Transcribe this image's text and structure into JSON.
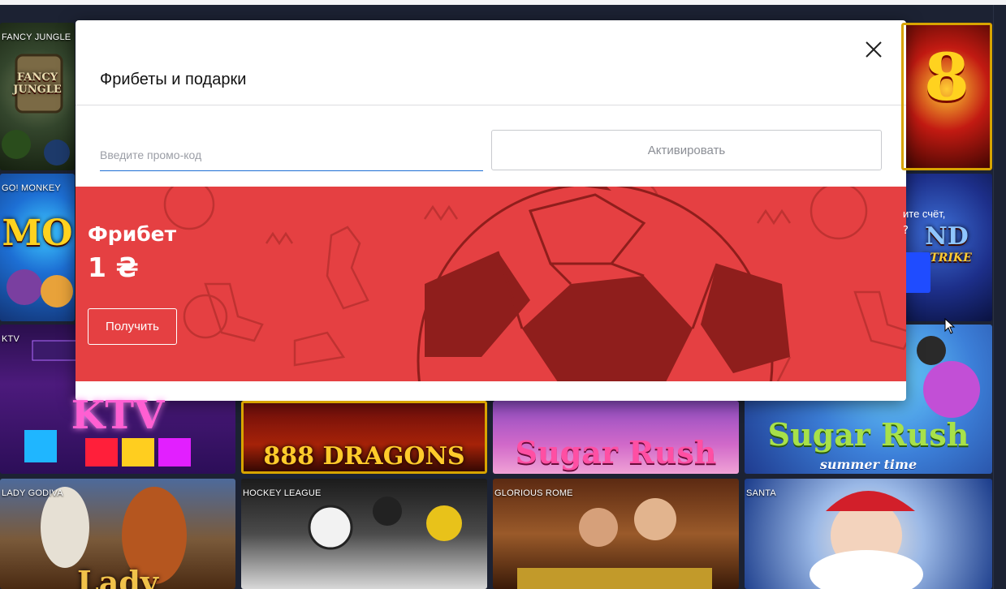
{
  "modal": {
    "title": "Фрибеты и подарки",
    "promo_placeholder": "Введите промо-код",
    "activate_label": "Активировать",
    "banner": {
      "title": "Фрибет",
      "amount": "1 ₴",
      "button_label": "Получить",
      "color": "#e54042"
    }
  },
  "games": [
    {
      "name": "FANCY JUNGLE",
      "logo": "FANCY JUNGLE"
    },
    {
      "name": "GO! MONKEY",
      "logo": "MO"
    },
    {
      "name": "KTV",
      "logo": "KTV"
    },
    {
      "name": "888 DRAGONS",
      "logo": "888 DRAGONS"
    },
    {
      "name": "Sugar Rush",
      "logo": "Sugar Rush"
    },
    {
      "name": "Sugar Rush summer time",
      "logo": "Sugar Rush",
      "sublogo": "summer time"
    },
    {
      "name": "LADY GODIVA",
      "logo": "Lady"
    },
    {
      "name": "HOCKEY LEAGUE"
    },
    {
      "name": "GLORIOUS ROME"
    },
    {
      "name": "SANTA"
    },
    {
      "name": "8",
      "logo": "8"
    },
    {
      "name": "STRIKE",
      "logo": "ND",
      "sublogo": "STRIKE"
    }
  ],
  "background_peek": {
    "text": "ите счёт,",
    "text2": "?"
  },
  "accent_color": "#1d6fd4"
}
